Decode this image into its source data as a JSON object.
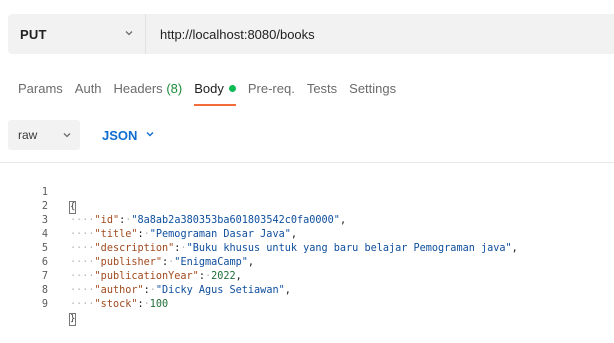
{
  "request": {
    "method": "PUT",
    "url": "http://localhost:8080/books"
  },
  "tabs": [
    {
      "label": "Params",
      "active": false
    },
    {
      "label": "Auth",
      "active": false
    },
    {
      "label": "Headers",
      "count": "(8)",
      "active": false
    },
    {
      "label": "Body",
      "active": true,
      "indicator": "green-dot"
    },
    {
      "label": "Pre-req.",
      "active": false
    },
    {
      "label": "Tests",
      "active": false
    },
    {
      "label": "Settings",
      "active": false
    }
  ],
  "body": {
    "mode": "raw",
    "format": "JSON"
  },
  "editor": {
    "line_numbers": [
      "1",
      "2",
      "3",
      "4",
      "5",
      "6",
      "7",
      "8",
      "9"
    ],
    "fields": {
      "id": "8a8ab2a380353ba601803542c0fa0000",
      "title": "Pemograman Dasar Java",
      "description": "Buku khusus untuk yang baru belajar Pemograman java",
      "publisher": "EnigmaCamp",
      "publicationYear": 2022,
      "author": "Dicky Agus Setiawan",
      "stock": 100
    },
    "open_brace": "{",
    "close_brace": "}"
  },
  "colors": {
    "accent_orange": "#f26b3a",
    "status_green": "#0cbb52",
    "link_blue": "#0f6dd0"
  }
}
